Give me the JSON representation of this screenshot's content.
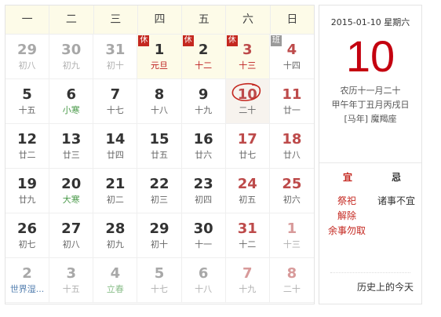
{
  "weekdays": [
    "一",
    "二",
    "三",
    "四",
    "五",
    "六",
    "日"
  ],
  "days": [
    {
      "day": "29",
      "lunar": "初八",
      "other": true
    },
    {
      "day": "30",
      "lunar": "初九",
      "other": true
    },
    {
      "day": "31",
      "lunar": "初十",
      "other": true
    },
    {
      "day": "1",
      "lunar": "元旦",
      "badge": "休",
      "holiday": true
    },
    {
      "day": "2",
      "lunar": "十二",
      "badge": "休",
      "holiday": true
    },
    {
      "day": "3",
      "lunar": "十三",
      "badge": "休",
      "holiday": true,
      "weekend": true
    },
    {
      "day": "4",
      "lunar": "十四",
      "badge": "班",
      "weekend": true
    },
    {
      "day": "5",
      "lunar": "十五"
    },
    {
      "day": "6",
      "lunar": "小寒",
      "term": true
    },
    {
      "day": "7",
      "lunar": "十七"
    },
    {
      "day": "8",
      "lunar": "十八"
    },
    {
      "day": "9",
      "lunar": "十九"
    },
    {
      "day": "10",
      "lunar": "二十",
      "weekend": true,
      "today": true
    },
    {
      "day": "11",
      "lunar": "廿一",
      "weekend": true
    },
    {
      "day": "12",
      "lunar": "廿二"
    },
    {
      "day": "13",
      "lunar": "廿三"
    },
    {
      "day": "14",
      "lunar": "廿四"
    },
    {
      "day": "15",
      "lunar": "廿五"
    },
    {
      "day": "16",
      "lunar": "廿六"
    },
    {
      "day": "17",
      "lunar": "廿七",
      "weekend": true
    },
    {
      "day": "18",
      "lunar": "廿八",
      "weekend": true
    },
    {
      "day": "19",
      "lunar": "廿九"
    },
    {
      "day": "20",
      "lunar": "大寒",
      "term": true
    },
    {
      "day": "21",
      "lunar": "初二"
    },
    {
      "day": "22",
      "lunar": "初三"
    },
    {
      "day": "23",
      "lunar": "初四"
    },
    {
      "day": "24",
      "lunar": "初五",
      "weekend": true
    },
    {
      "day": "25",
      "lunar": "初六",
      "weekend": true
    },
    {
      "day": "26",
      "lunar": "初七"
    },
    {
      "day": "27",
      "lunar": "初八"
    },
    {
      "day": "28",
      "lunar": "初九"
    },
    {
      "day": "29",
      "lunar": "初十"
    },
    {
      "day": "30",
      "lunar": "十一"
    },
    {
      "day": "31",
      "lunar": "十二",
      "weekend": true
    },
    {
      "day": "1",
      "lunar": "十三",
      "other": true,
      "weekend": true
    },
    {
      "day": "2",
      "lunar": "世界湿...",
      "other": true,
      "festival": true
    },
    {
      "day": "3",
      "lunar": "十五",
      "other": true
    },
    {
      "day": "4",
      "lunar": "立春",
      "other": true,
      "term": true
    },
    {
      "day": "5",
      "lunar": "十七",
      "other": true
    },
    {
      "day": "6",
      "lunar": "十八",
      "other": true
    },
    {
      "day": "7",
      "lunar": "十九",
      "other": true,
      "weekend": true
    },
    {
      "day": "8",
      "lunar": "二十",
      "other": true,
      "weekend": true
    }
  ],
  "side": {
    "date": "2015-01-10",
    "weekday": "星期六",
    "big_day": "10",
    "lunar_date": "农历十一月二十",
    "ganzhi": "甲午年丁丑月丙戌日",
    "zodiac_year": "[马年]",
    "constellation": "魔羯座",
    "yi_title": "宜",
    "ji_title": "忌",
    "yi_items": [
      "祭祀",
      "解除",
      "余事勿取"
    ],
    "ji_items": [
      "诸事不宜"
    ],
    "history_link": "历史上的今天"
  },
  "colors": {
    "accent_red": "#c4000f",
    "weekend_red": "#bd4a4a",
    "header_bg": "#fdfbe8",
    "term_green": "#4a9a4a"
  }
}
